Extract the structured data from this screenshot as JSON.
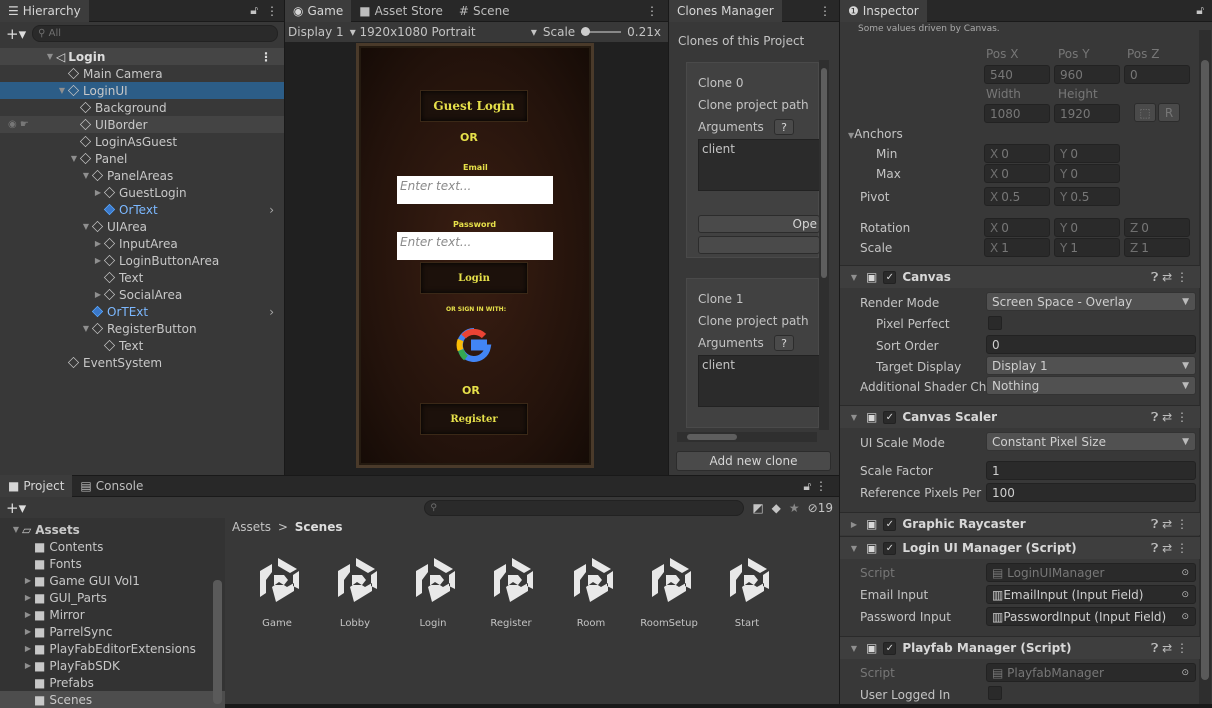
{
  "hierarchy": {
    "tab": "Hierarchy",
    "search_placeholder": "All",
    "scene": "Login",
    "items": [
      {
        "label": "Main Camera",
        "depth": 0
      },
      {
        "label": "LoginUI",
        "depth": 0
      },
      {
        "label": "Background",
        "depth": 1
      },
      {
        "label": "UIBorder",
        "depth": 1
      },
      {
        "label": "LoginAsGuest",
        "depth": 1
      },
      {
        "label": "Panel",
        "depth": 1
      },
      {
        "label": "PanelAreas",
        "depth": 2
      },
      {
        "label": "GuestLogin",
        "depth": 3
      },
      {
        "label": "OrText",
        "depth": 3
      },
      {
        "label": "UIArea",
        "depth": 2
      },
      {
        "label": "InputArea",
        "depth": 3
      },
      {
        "label": "LoginButtonArea",
        "depth": 3
      },
      {
        "label": "Text",
        "depth": 3
      },
      {
        "label": "SocialArea",
        "depth": 3
      },
      {
        "label": "OrTExt",
        "depth": 2
      },
      {
        "label": "RegisterButton",
        "depth": 2
      },
      {
        "label": "Text",
        "depth": 3
      },
      {
        "label": "EventSystem",
        "depth": 0
      }
    ]
  },
  "game": {
    "tabs": [
      "Game",
      "Asset Store",
      "Scene"
    ],
    "display": "Display 1",
    "resolution": "1920x1080 Portrait",
    "scale_label": "Scale",
    "scale_value": "0.21x",
    "guest_login": "Guest Login",
    "or1": "OR",
    "email_label": "Email",
    "email_placeholder": "Enter text...",
    "password_label": "Password",
    "password_placeholder": "Enter text...",
    "login": "Login",
    "or_sign_in": "OR SIGN IN WITH:",
    "or2": "OR",
    "register": "Register"
  },
  "clones": {
    "tab": "Clones Manager",
    "title": "Clones of this Project",
    "items": [
      {
        "name": "Clone 0",
        "path_label": "Clone project path",
        "arguments_label": "Arguments",
        "help": "?",
        "args": "client",
        "open": "Ope"
      },
      {
        "name": "Clone 1",
        "path_label": "Clone project path",
        "arguments_label": "Arguments",
        "help": "?",
        "args": "client"
      }
    ],
    "add": "Add new clone"
  },
  "inspector": {
    "tab": "Inspector",
    "note": "Some values driven by Canvas.",
    "pos_x_label": "Pos X",
    "pos_y_label": "Pos Y",
    "pos_z_label": "Pos Z",
    "pos_x": "540",
    "pos_y": "960",
    "pos_z": "0",
    "width_label": "Width",
    "height_label": "Height",
    "width": "1080",
    "height": "1920",
    "r_btn": "R",
    "anchors": "Anchors",
    "min": "Min",
    "max": "Max",
    "min_x": "0",
    "min_y": "0",
    "max_x": "0",
    "max_y": "0",
    "pivot": "Pivot",
    "pivot_x": "0.5",
    "pivot_y": "0.5",
    "rotation": "Rotation",
    "rot_x": "0",
    "rot_y": "0",
    "rot_z": "0",
    "scale": "Scale",
    "scale_x": "1",
    "scale_y": "1",
    "scale_z": "1",
    "x": "X",
    "y": "Y",
    "z": "Z",
    "canvas": {
      "title": "Canvas",
      "render_mode_label": "Render Mode",
      "render_mode": "Screen Space - Overlay",
      "pixel_perfect": "Pixel Perfect",
      "sort_order_label": "Sort Order",
      "sort_order": "0",
      "target_display_label": "Target Display",
      "target_display": "Display 1",
      "shader_label": "Additional Shader Ch",
      "shader": "Nothing"
    },
    "scaler": {
      "title": "Canvas Scaler",
      "mode_label": "UI Scale Mode",
      "mode": "Constant Pixel Size",
      "factor_label": "Scale Factor",
      "factor": "1",
      "ref_label": "Reference Pixels Per",
      "ref": "100"
    },
    "raycaster": {
      "title": "Graphic Raycaster"
    },
    "login_mgr": {
      "title": "Login UI Manager (Script)",
      "script_label": "Script",
      "script": "LoginUIManager",
      "email_label": "Email Input",
      "email": "EmailInput (Input Field)",
      "password_label": "Password Input",
      "password": "PasswordInput (Input Field)"
    },
    "playfab": {
      "title": "Playfab Manager (Script)",
      "script_label": "Script",
      "script": "PlayfabManager",
      "logged_label": "User Logged In"
    }
  },
  "project": {
    "tabs": [
      "Project",
      "Console"
    ],
    "count": "19",
    "breadcrumb_root": "Assets",
    "breadcrumb_sep": ">",
    "breadcrumb_leaf": "Scenes",
    "tree": [
      "Assets",
      "Contents",
      "Fonts",
      "Game GUI Vol1",
      "GUI_Parts",
      "Mirror",
      "ParrelSync",
      "PlayFabEditorExtensions",
      "PlayFabSDK",
      "Prefabs",
      "Scenes"
    ],
    "scenes": [
      "Game",
      "Lobby",
      "Login",
      "Register",
      "Room",
      "RoomSetup",
      "Start"
    ]
  }
}
